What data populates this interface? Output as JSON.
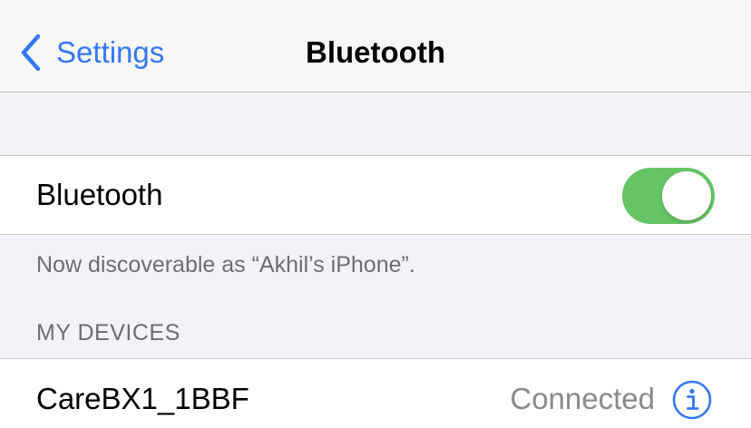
{
  "navbar": {
    "back_label": "Settings",
    "back_icon": "chevron-left-icon",
    "title": "Bluetooth"
  },
  "bluetooth_cell": {
    "label": "Bluetooth",
    "toggle_on": true
  },
  "discoverable_text": "Now discoverable as “Akhil’s iPhone”.",
  "my_devices": {
    "header": "MY DEVICES",
    "items": [
      {
        "name": "CareBX1_1BBF",
        "status": "Connected",
        "icon": "info-icon"
      }
    ]
  },
  "colors": {
    "accent": "#3478f6",
    "toggle_on": "#65c466",
    "background": "#f2f2f7",
    "secondary_text": "#6d6d72"
  }
}
